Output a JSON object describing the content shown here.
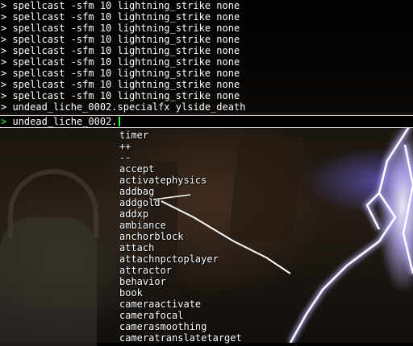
{
  "console": {
    "history": [
      "> spellcast -sfm 10 lightning_strike none",
      "> spellcast -sfm 10 lightning_strike none",
      "> spellcast -sfm 10 lightning_strike none",
      "> spellcast -sfm 10 lightning_strike none",
      "> spellcast -sfm 10 lightning_strike none",
      "> spellcast -sfm 10 lightning_strike none",
      "> spellcast -sfm 10 lightning_strike none",
      "> spellcast -sfm 10 lightning_strike none",
      "> spellcast -sfm 10 lightning_strike none",
      "> undead_liche_0002.specialfx ylside_death"
    ],
    "prompt_symbol": ">",
    "input_value": "undead_liche_0002.",
    "colors": {
      "text": "#ffffff",
      "prompt": "#33ff33",
      "input_border": "#cfcfcf"
    }
  },
  "autocomplete": {
    "items": [
      "timer",
      "++",
      "--",
      "accept",
      "activatephysics",
      "addbag",
      "addgold",
      "addxp",
      "ambiance",
      "anchorblock",
      "attach",
      "attachnpctoplayer",
      "attractor",
      "behavior",
      "book",
      "cameraactivate",
      "camerafocal",
      "camerasmoothing",
      "cameratranslatetarget"
    ]
  }
}
